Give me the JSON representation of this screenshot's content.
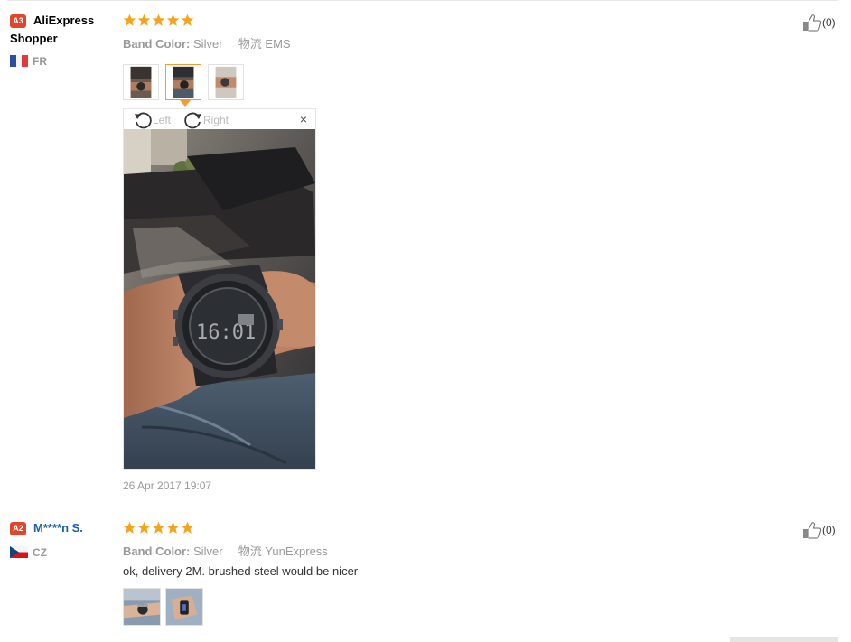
{
  "reviews": [
    {
      "badge": "A3",
      "name": "AliExpress Shopper",
      "name_line1": "AliExpress",
      "name_line2": "Shopper",
      "country": "FR",
      "rating": 5,
      "band_label": "Band Color:",
      "band_value": "Silver",
      "shipping_label": "物流",
      "shipping_value": "EMS",
      "like_count": "(0)",
      "photo_count": 3,
      "viewer": {
        "left_label": "Left",
        "right_label": "Right",
        "close": "×"
      },
      "date": "26 Apr 2017 19:07",
      "watch_time": "16:01"
    },
    {
      "badge": "A2",
      "name": "M****n S.",
      "country": "CZ",
      "rating": 5,
      "band_label": "Band Color:",
      "band_value": "Silver",
      "shipping_label": "物流",
      "shipping_value": "YunExpress",
      "like_count": "(0)",
      "comment": "ok, delivery 2M. brushed steel would be nicer",
      "photo_count": 2
    }
  ],
  "colors": {
    "badge": "#e0462a",
    "star": "#f7a21b",
    "link_blue": "#1b5fa8",
    "active_border": "#f29c31"
  },
  "icons": {
    "like": "thumbs-up-icon",
    "rotate_left": "rotate-left-icon",
    "rotate_right": "rotate-right-icon",
    "close": "close-icon",
    "star": "star-icon"
  }
}
